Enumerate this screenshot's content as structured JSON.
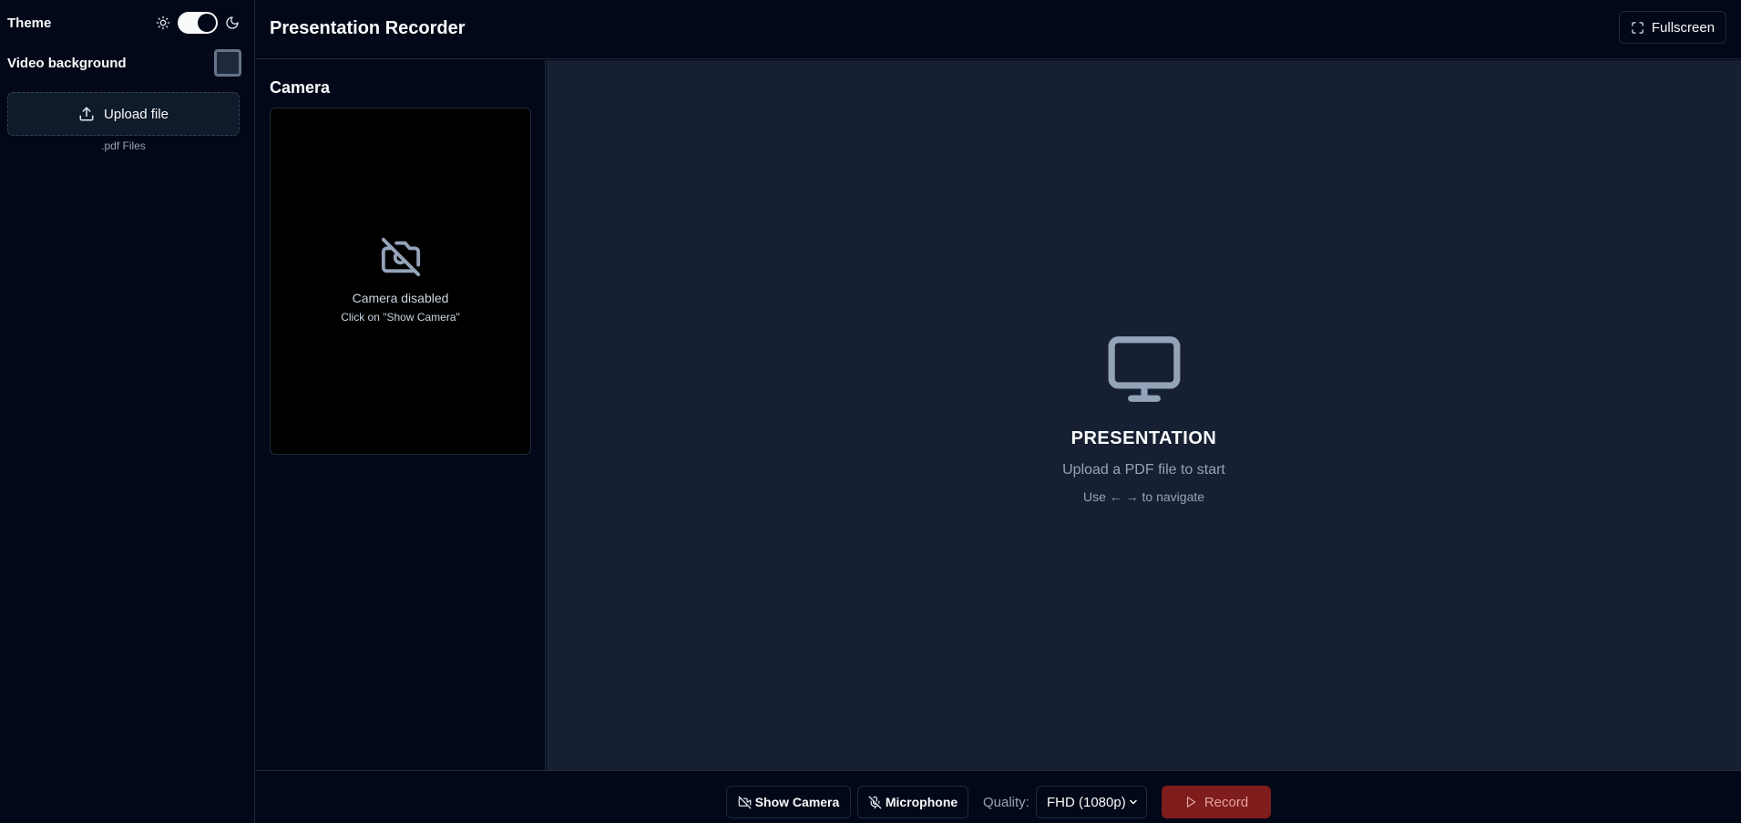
{
  "sidebar": {
    "theme_label": "Theme",
    "video_background_label": "Video background",
    "upload_label": "Upload file",
    "upload_hint": ".pdf Files"
  },
  "header": {
    "title": "Presentation Recorder",
    "fullscreen_label": "Fullscreen"
  },
  "camera": {
    "title": "Camera",
    "disabled_text": "Camera disabled",
    "hint_text": "Click on \"Show Camera\""
  },
  "presentation": {
    "title": "PRESENTATION",
    "subtitle": "Upload a PDF file to start",
    "hint": "Use ← → to navigate"
  },
  "toolbar": {
    "show_camera_label": "Show Camera",
    "microphone_label": "Microphone",
    "quality_label": "Quality:",
    "quality_value": "FHD (1080p)",
    "record_label": "Record"
  },
  "icons": {
    "theme_light": "sun-icon",
    "theme_dark": "moon-icon",
    "upload": "upload-icon",
    "fullscreen": "expand-icon",
    "camera_off": "camera-off-icon",
    "presentation": "monitor-icon",
    "mic_off": "mic-off-icon",
    "record": "play-icon"
  },
  "colors": {
    "background": "#020817",
    "presentation_bg": "#162032",
    "record_button": "#7f1d1d"
  },
  "state": {
    "theme_dark": true,
    "video_background_checked": false
  }
}
